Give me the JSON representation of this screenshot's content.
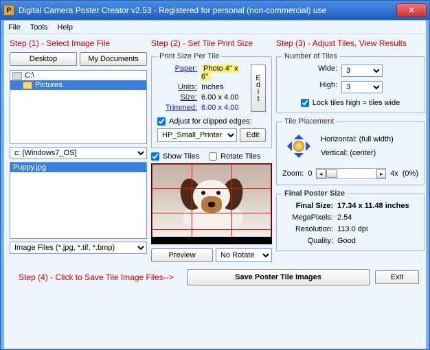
{
  "window": {
    "title": "Digital Camera Poster Creator v2.53 - Registered for personal (non-commercial) use"
  },
  "menu": {
    "file": "File",
    "tools": "Tools",
    "help": "Help"
  },
  "step1": {
    "header": "Step (1) - Select Image File",
    "desktop": "Desktop",
    "mydocs": "My Documents",
    "drive_c": "C:\\",
    "folder_pictures": "Pictures",
    "drive_combo": "c: [Windows7_OS]",
    "file_selected": "Puppy.jpg",
    "filter": "Image Files (*.jpg, *.tif, *.bmp)"
  },
  "step2": {
    "header": "Step (2) - Set Tile Print Size",
    "legend": "Print Size Per Tile",
    "paper_lab": "Paper:",
    "paper_val": "Photo 4'' x 6''",
    "units_lab": "Units:",
    "units_val": "Inches",
    "size_lab": "Size:",
    "size_val": "6.00 x 4.00",
    "trimmed_lab": "Trimmed:",
    "trimmed_val": "6.00 x 4.00",
    "edit": "E\nd\ni\nt",
    "adjust_label": "Adjust for clipped edges:",
    "printer": "HP_Small_Printer",
    "edit2": "Edit",
    "show_tiles": "Show Tiles",
    "rotate_tiles": "Rotate Tiles",
    "preview_btn": "Preview",
    "rotate_combo": "No Rotate"
  },
  "step3": {
    "header": "Step (3) - Adjust Tiles, View Results",
    "num_legend": "Number of Tiles",
    "wide": "Wide:",
    "high": "High:",
    "wide_v": "3",
    "high_v": "3",
    "lock": "Lock tiles high = tiles wide",
    "place_legend": "Tile Placement",
    "horiz_l": "Horizontal:",
    "horiz_v": "(full width)",
    "vert_l": "Vertical:",
    "vert_v": "(center)",
    "zoom_l": "Zoom:",
    "zoom_min": "0",
    "zoom_max": "4x",
    "zoom_pct": "(0%)",
    "final_legend": "Final Poster Size",
    "final_size_l": "Final Size:",
    "final_size_v": "17.34 x 11.48 inches",
    "mp_l": "MegaPixels:",
    "mp_v": "2.54",
    "res_l": "Resolution:",
    "res_v": "113.0 dpi",
    "qual_l": "Quality:",
    "qual_v": "Good"
  },
  "step4": {
    "hint": "Step (4) - Click to Save Tile Image Files-->",
    "save": "Save Poster Tile Images",
    "exit": "Exit"
  }
}
